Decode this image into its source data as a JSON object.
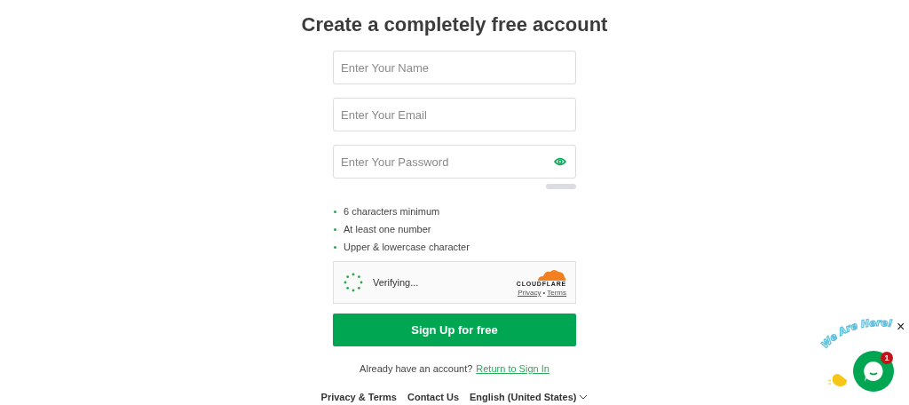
{
  "title": "Create a completely free account",
  "fields": [
    {
      "placeholder": "Enter Your Name",
      "kind": "text"
    },
    {
      "placeholder": "Enter Your Email",
      "kind": "text"
    },
    {
      "placeholder": "Enter Your Password",
      "kind": "password"
    }
  ],
  "strength": {
    "level": 0
  },
  "requirements": [
    {
      "text": "6 characters minimum"
    },
    {
      "text": "At least one number"
    },
    {
      "text": "Upper & lowercase character"
    }
  ],
  "captcha": {
    "status": "Verifying...",
    "brand": "CLOUDFLARE",
    "links": [
      "Privacy",
      "•",
      "Terms"
    ]
  },
  "signup_button": "Sign Up for free",
  "signin": {
    "prompt": "Already have an account?",
    "link": "Return to Sign In"
  },
  "footer": {
    "links": [
      "Privacy & Terms",
      "Contact Us"
    ],
    "language": "English (United States)"
  },
  "chat_widget": {
    "banner": "We Are Here!",
    "badge": "1",
    "close": "×"
  }
}
